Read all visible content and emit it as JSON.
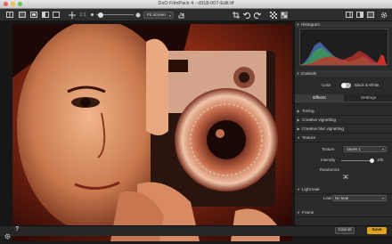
{
  "window": {
    "title": "DxO FilmPack 4 - d318-007-Edit.tif"
  },
  "toolbar": {
    "zoom_ratio": "1:1",
    "fit_option": "Fit screen"
  },
  "panel": {
    "histogram_label": "Histogram",
    "controls_label": "Controls",
    "color_label": "Color",
    "bw_label": "Black & White",
    "tabs": [
      "Effects",
      "Settings"
    ],
    "sections": [
      {
        "label": "Toning",
        "expanded": false
      },
      {
        "label": "Creative vignetting",
        "expanded": false
      },
      {
        "label": "Creative blur vignetting",
        "expanded": false
      },
      {
        "label": "Texture",
        "expanded": true
      }
    ],
    "texture": {
      "texture_label": "Texture",
      "texture_value": "Stains 1",
      "intensity_label": "Intensity",
      "intensity_value": "100",
      "intensity_level": 1.0,
      "randomize_label": "Randomize"
    },
    "light_leak": {
      "label": "Light leak",
      "leak_label": "Leak",
      "leak_value": "No leak"
    },
    "frame": {
      "label": "Frame"
    }
  },
  "footer": {
    "cancel_label": "Cancel",
    "save_label": "Save"
  },
  "colors": {
    "accent": "#e0a21a",
    "panel": "#2a2a2a",
    "background": "#1b1b1b"
  }
}
